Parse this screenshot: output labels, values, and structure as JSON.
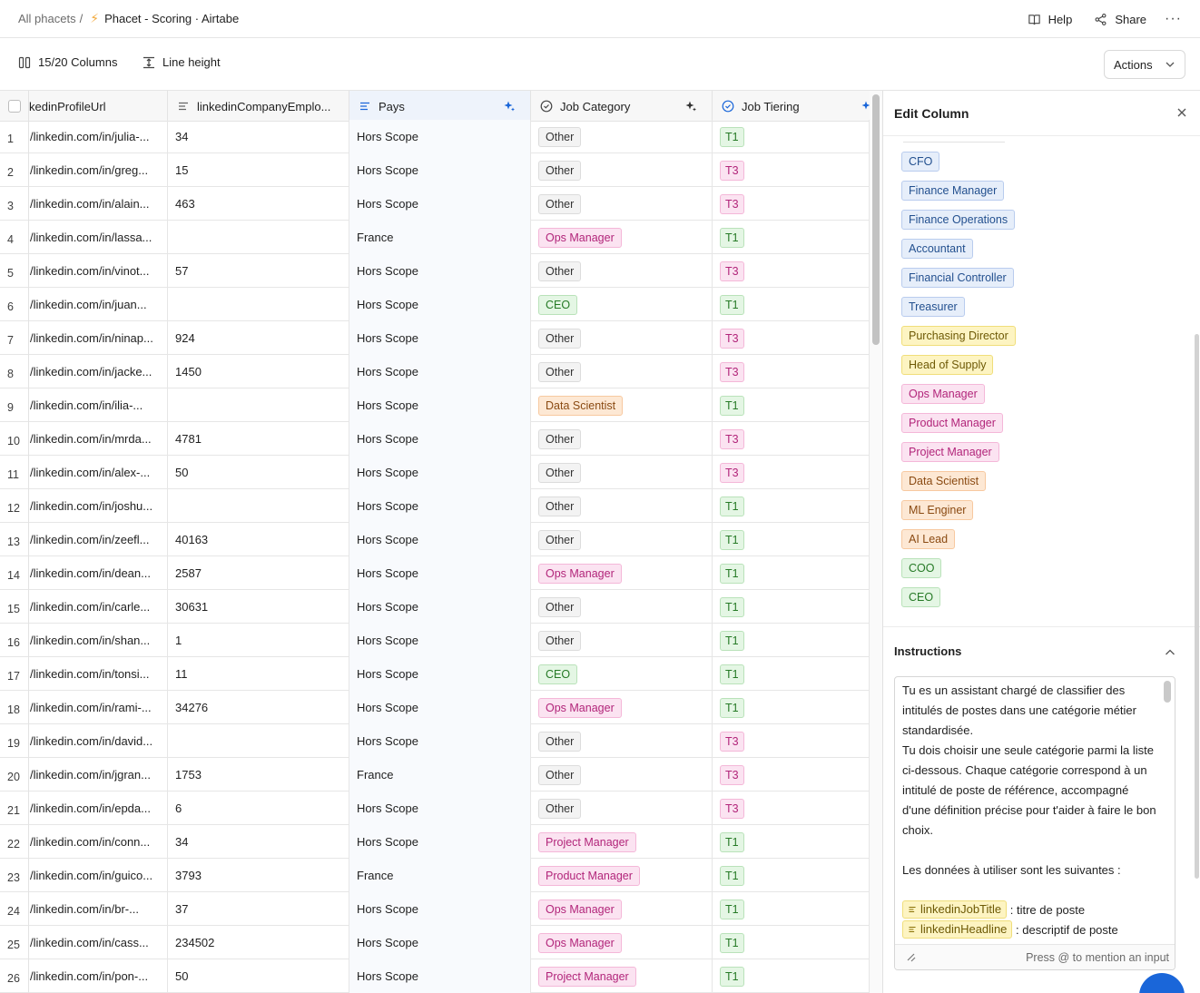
{
  "breadcrumb": {
    "parent": "All phacets",
    "separator": "/",
    "icon": "bolt-icon",
    "title": "Phacet - Scoring · Airtabe"
  },
  "topbar": {
    "help": "Help",
    "share": "Share",
    "more": "···"
  },
  "toolbar": {
    "columns": "15/20 Columns",
    "line_height": "Line height",
    "actions": "Actions"
  },
  "columns": [
    {
      "label": "kedinProfileUrl"
    },
    {
      "label": "linkedinCompanyEmplo..."
    },
    {
      "label": "Pays"
    },
    {
      "label": "Job Category"
    },
    {
      "label": "Job Tiering"
    }
  ],
  "rows": [
    {
      "n": "1",
      "url": "/linkedin.com/in/julia-...",
      "emp": "34",
      "pays": "Hors Scope",
      "cat": "Other",
      "catc": "gray",
      "tier": "T1"
    },
    {
      "n": "2",
      "url": "/linkedin.com/in/greg...",
      "emp": "15",
      "pays": "Hors Scope",
      "cat": "Other",
      "catc": "gray",
      "tier": "T3"
    },
    {
      "n": "3",
      "url": "/linkedin.com/in/alain...",
      "emp": "463",
      "pays": "Hors Scope",
      "cat": "Other",
      "catc": "gray",
      "tier": "T3"
    },
    {
      "n": "4",
      "url": "/linkedin.com/in/lassa...",
      "emp": "",
      "pays": "France",
      "cat": "Ops Manager",
      "catc": "pink",
      "tier": "T1"
    },
    {
      "n": "5",
      "url": "/linkedin.com/in/vinot...",
      "emp": "57",
      "pays": "Hors Scope",
      "cat": "Other",
      "catc": "gray",
      "tier": "T3"
    },
    {
      "n": "6",
      "url": "/linkedin.com/in/juan...",
      "emp": "",
      "pays": "Hors Scope",
      "cat": "CEO",
      "catc": "green",
      "tier": "T1"
    },
    {
      "n": "7",
      "url": "/linkedin.com/in/ninap...",
      "emp": "924",
      "pays": "Hors Scope",
      "cat": "Other",
      "catc": "gray",
      "tier": "T3"
    },
    {
      "n": "8",
      "url": "/linkedin.com/in/jacke...",
      "emp": "1450",
      "pays": "Hors Scope",
      "cat": "Other",
      "catc": "gray",
      "tier": "T3"
    },
    {
      "n": "9",
      "url": "/linkedin.com/in/ilia-...",
      "emp": "",
      "pays": "Hors Scope",
      "cat": "Data Scientist",
      "catc": "orange",
      "tier": "T1"
    },
    {
      "n": "10",
      "url": "/linkedin.com/in/mrda...",
      "emp": "4781",
      "pays": "Hors Scope",
      "cat": "Other",
      "catc": "gray",
      "tier": "T3"
    },
    {
      "n": "11",
      "url": "/linkedin.com/in/alex-...",
      "emp": "50",
      "pays": "Hors Scope",
      "cat": "Other",
      "catc": "gray",
      "tier": "T3"
    },
    {
      "n": "12",
      "url": "/linkedin.com/in/joshu...",
      "emp": "",
      "pays": "Hors Scope",
      "cat": "Other",
      "catc": "gray",
      "tier": "T1"
    },
    {
      "n": "13",
      "url": "/linkedin.com/in/zeefl...",
      "emp": "40163",
      "pays": "Hors Scope",
      "cat": "Other",
      "catc": "gray",
      "tier": "T1"
    },
    {
      "n": "14",
      "url": "/linkedin.com/in/dean...",
      "emp": "2587",
      "pays": "Hors Scope",
      "cat": "Ops Manager",
      "catc": "pink",
      "tier": "T1"
    },
    {
      "n": "15",
      "url": "/linkedin.com/in/carle...",
      "emp": "30631",
      "pays": "Hors Scope",
      "cat": "Other",
      "catc": "gray",
      "tier": "T1"
    },
    {
      "n": "16",
      "url": "/linkedin.com/in/shan...",
      "emp": "1",
      "pays": "Hors Scope",
      "cat": "Other",
      "catc": "gray",
      "tier": "T1"
    },
    {
      "n": "17",
      "url": "/linkedin.com/in/tonsi...",
      "emp": "11",
      "pays": "Hors Scope",
      "cat": "CEO",
      "catc": "green",
      "tier": "T1"
    },
    {
      "n": "18",
      "url": "/linkedin.com/in/rami-...",
      "emp": "34276",
      "pays": "Hors Scope",
      "cat": "Ops Manager",
      "catc": "pink",
      "tier": "T1"
    },
    {
      "n": "19",
      "url": "/linkedin.com/in/david...",
      "emp": "",
      "pays": "Hors Scope",
      "cat": "Other",
      "catc": "gray",
      "tier": "T3"
    },
    {
      "n": "20",
      "url": "/linkedin.com/in/jgran...",
      "emp": "1753",
      "pays": "France",
      "cat": "Other",
      "catc": "gray",
      "tier": "T3"
    },
    {
      "n": "21",
      "url": "/linkedin.com/in/epda...",
      "emp": "6",
      "pays": "Hors Scope",
      "cat": "Other",
      "catc": "gray",
      "tier": "T3"
    },
    {
      "n": "22",
      "url": "/linkedin.com/in/conn...",
      "emp": "34",
      "pays": "Hors Scope",
      "cat": "Project Manager",
      "catc": "pink",
      "tier": "T1"
    },
    {
      "n": "23",
      "url": "/linkedin.com/in/guico...",
      "emp": "3793",
      "pays": "France",
      "cat": "Product Manager",
      "catc": "pink",
      "tier": "T1"
    },
    {
      "n": "24",
      "url": "/linkedin.com/in/br-...",
      "emp": "37",
      "pays": "Hors Scope",
      "cat": "Ops Manager",
      "catc": "pink",
      "tier": "T1"
    },
    {
      "n": "25",
      "url": "/linkedin.com/in/cass...",
      "emp": "234502",
      "pays": "Hors Scope",
      "cat": "Ops Manager",
      "catc": "pink",
      "tier": "T1"
    },
    {
      "n": "26",
      "url": "/linkedin.com/in/pon-...",
      "emp": "50",
      "pays": "Hors Scope",
      "cat": "Project Manager",
      "catc": "pink",
      "tier": "T1"
    }
  ],
  "panel": {
    "title": "Edit Column",
    "options": [
      {
        "label": "CFO",
        "color": "blue"
      },
      {
        "label": "Finance Manager",
        "color": "blue"
      },
      {
        "label": "Finance Operations",
        "color": "blue"
      },
      {
        "label": "Accountant",
        "color": "blue"
      },
      {
        "label": "Financial Controller",
        "color": "blue"
      },
      {
        "label": "Treasurer",
        "color": "blue"
      },
      {
        "label": "Purchasing Director",
        "color": "yellow"
      },
      {
        "label": "Head of Supply",
        "color": "yellow"
      },
      {
        "label": "Ops Manager",
        "color": "pink"
      },
      {
        "label": "Product Manager",
        "color": "pink"
      },
      {
        "label": "Project Manager",
        "color": "pink"
      },
      {
        "label": "Data Scientist",
        "color": "orange"
      },
      {
        "label": "ML Enginer",
        "color": "orange"
      },
      {
        "label": "AI Lead",
        "color": "orange"
      },
      {
        "label": "COO",
        "color": "green"
      },
      {
        "label": "CEO",
        "color": "green"
      }
    ],
    "instructions_title": "Instructions",
    "instructions": {
      "p1": "Tu es un assistant chargé de classifier des intitulés de postes dans une catégorie métier standardisée.",
      "p2": "Tu dois choisir une seule catégorie parmi la liste ci-dessous. Chaque catégorie correspond à un intitulé de poste de référence, accompagné d'une définition précise pour t'aider à faire le bon choix.",
      "p3": "Les données à utiliser sont les suivantes :",
      "m1": "linkedinJobTitle",
      "m1_desc": " : titre de poste",
      "m2": "linkedinHeadline",
      "m2_desc": " : descriptif de poste"
    },
    "mention_hint": "Press @ to mention an input"
  },
  "colors": {
    "accent": "#1a66d9",
    "bolt": "#f2a93b"
  }
}
